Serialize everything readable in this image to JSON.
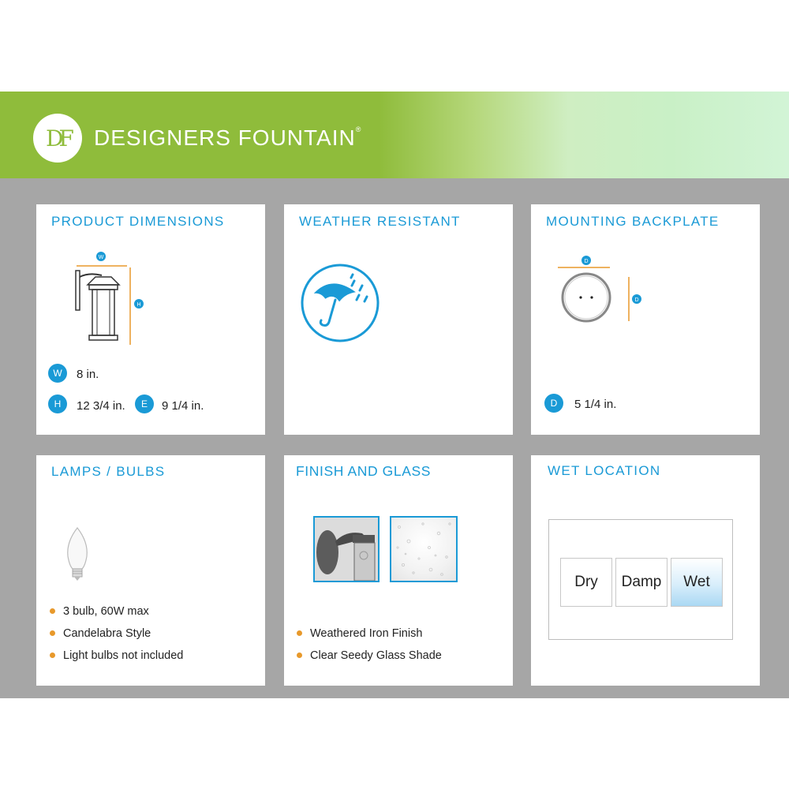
{
  "brand": {
    "name": "DESIGNERS FOUNTAIN",
    "mark": "®",
    "monogram": "DF"
  },
  "colors": {
    "accent": "#1a9ad6",
    "brand_green": "#8fbc3b",
    "bullet": "#e8992b",
    "panel_bg": "#a6a6a6"
  },
  "panels": {
    "dimensions": {
      "title": "PRODUCT DIMENSIONS",
      "diagram_w": "W",
      "diagram_h": "H",
      "w_badge": "W",
      "w_value": "8 in.",
      "h_badge": "H",
      "h_value": "12 3/4 in.",
      "e_badge": "E",
      "e_value": "9 1/4 in."
    },
    "weather": {
      "title": "WEATHER RESISTANT",
      "icon": "umbrella-rain-icon"
    },
    "backplate": {
      "title": "MOUNTING BACKPLATE",
      "diagram_d1": "D",
      "diagram_d2": "D",
      "d_badge": "D",
      "d_value": "5 1/4 in."
    },
    "lamps": {
      "title": "LAMPS / BULBS",
      "items": [
        "3 bulb, 60W max",
        "Candelabra Style",
        "Light bulbs not included"
      ]
    },
    "finish": {
      "title": "FINISH AND GLASS",
      "items": [
        "Weathered Iron Finish",
        "Clear Seedy Glass Shade"
      ]
    },
    "wet": {
      "title": "WET LOCATION",
      "options": [
        "Dry",
        "Damp",
        "Wet"
      ],
      "selected": "Wet"
    }
  }
}
